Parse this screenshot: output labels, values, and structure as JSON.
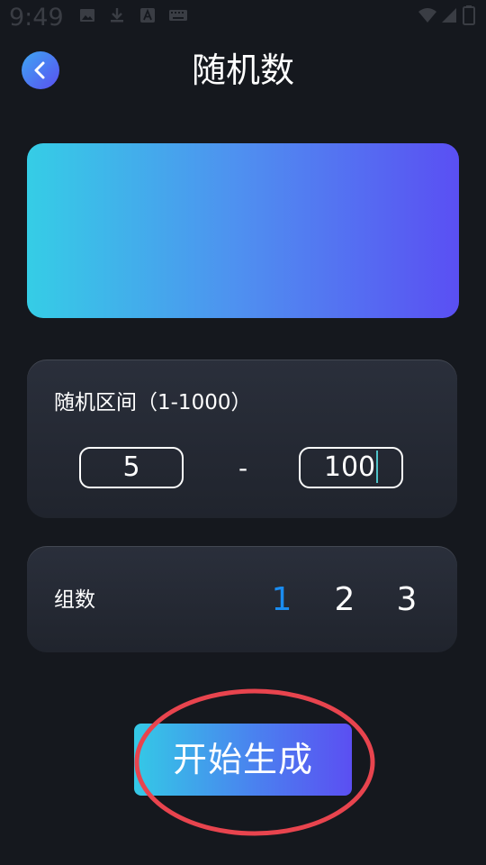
{
  "status_bar": {
    "time": "9:49",
    "icons": [
      "image-icon",
      "download-icon",
      "font-icon",
      "keyboard-icon",
      "wifi-icon",
      "signal-icon",
      "battery-icon"
    ]
  },
  "header": {
    "title": "随机数",
    "back_icon": "chevron-left-icon"
  },
  "range": {
    "label": "随机区间（1-1000）",
    "min_value": "5",
    "separator": "-",
    "max_value": "100"
  },
  "groups": {
    "label": "组数",
    "options": [
      "1",
      "2",
      "3"
    ],
    "selected": "1"
  },
  "actions": {
    "generate_label": "开始生成"
  },
  "colors": {
    "background": "#15181e",
    "accent_start": "#35cde6",
    "accent_end": "#5a4ff3",
    "selected_option": "#1a8cf0",
    "highlight_ring": "#e8444e"
  }
}
